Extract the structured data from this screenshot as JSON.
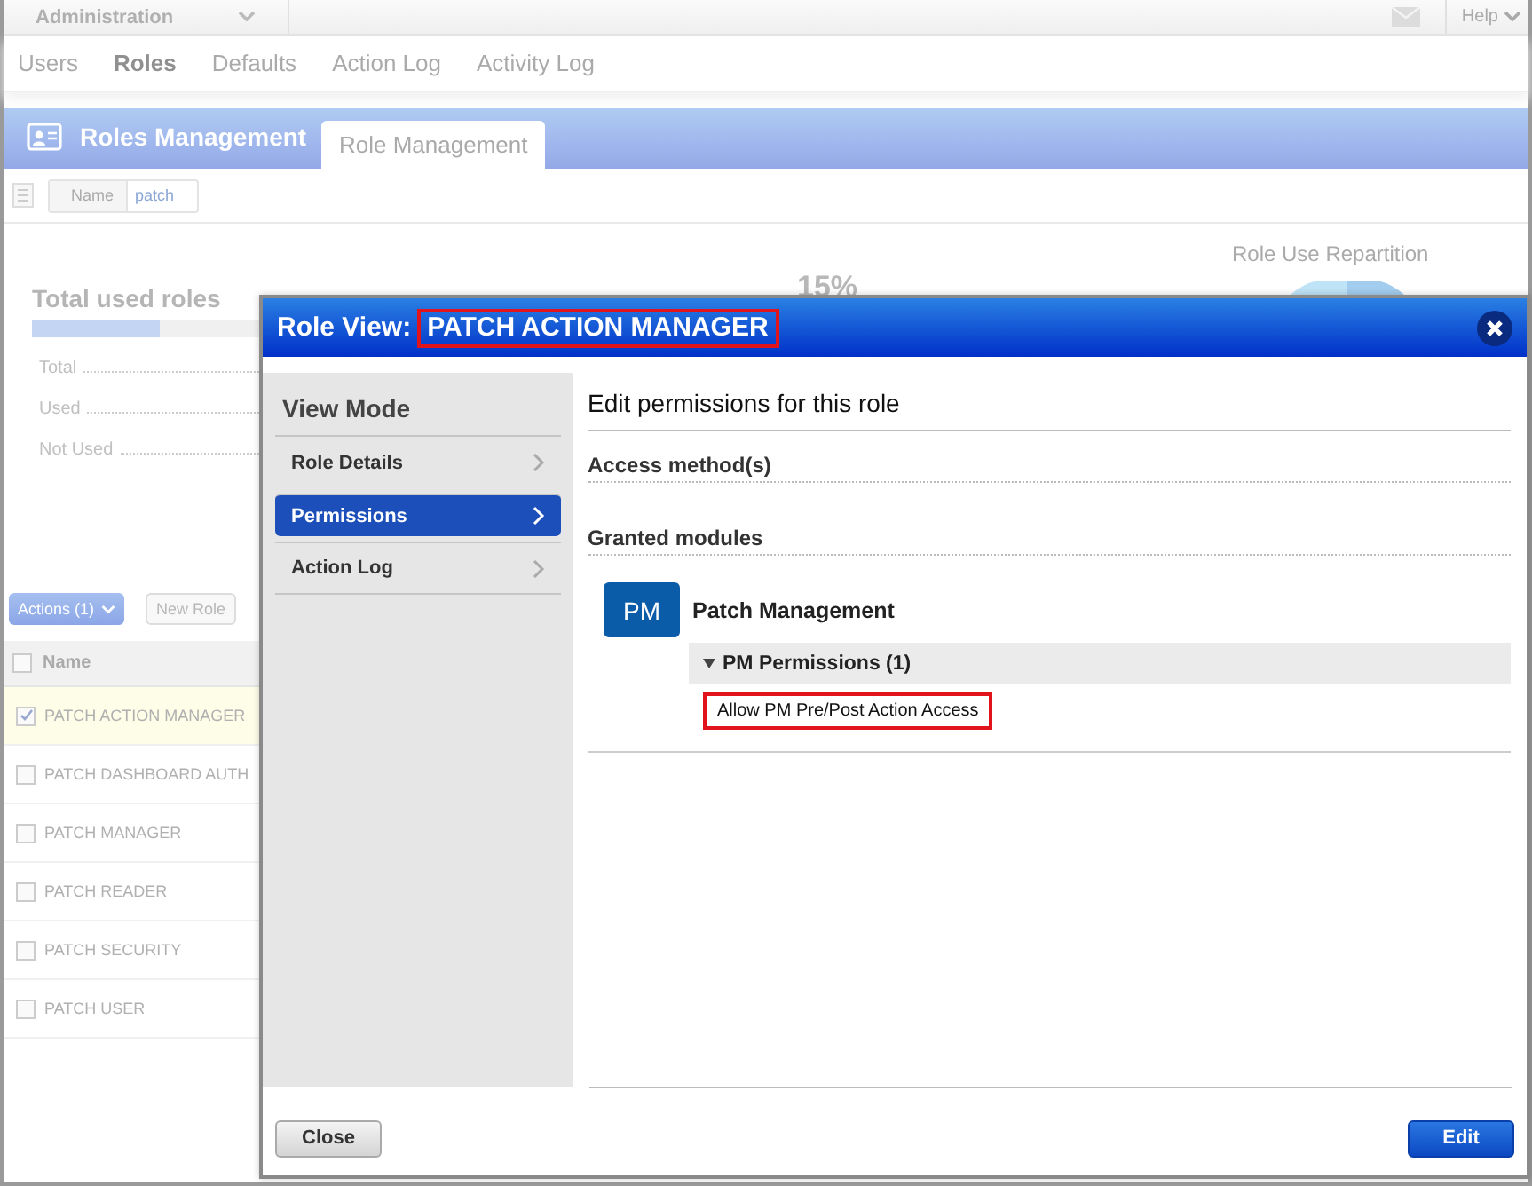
{
  "top_bar": {
    "app_menu": "Administration",
    "help": "Help"
  },
  "nav": [
    {
      "label": "Users",
      "selected": false
    },
    {
      "label": "Roles",
      "selected": true
    },
    {
      "label": "Defaults",
      "selected": false
    },
    {
      "label": "Action Log",
      "selected": false
    },
    {
      "label": "Activity Log",
      "selected": false
    }
  ],
  "header": {
    "title": "Roles Management",
    "tabs": [
      {
        "label": "Role Management",
        "selected": true
      }
    ]
  },
  "filter": {
    "label": "Name",
    "value": "patch"
  },
  "summary": {
    "title": "Total used roles",
    "level": 0.55,
    "rows": [
      "Total",
      "Used",
      "Not Used"
    ],
    "percent": "15%",
    "chart_title": "Role Use Repartition"
  },
  "toolbar": {
    "actions": "Actions (1)",
    "new_role": "New Role"
  },
  "table": {
    "column": "Name",
    "all_checked": false,
    "rows": [
      {
        "name": "PATCH ACTION MANAGER",
        "checked": true
      },
      {
        "name": "PATCH DASHBOARD AUTH",
        "checked": false
      },
      {
        "name": "PATCH MANAGER",
        "checked": false
      },
      {
        "name": "PATCH READER",
        "checked": false
      },
      {
        "name": "PATCH SECURITY",
        "checked": false
      },
      {
        "name": "PATCH USER",
        "checked": false
      }
    ]
  },
  "dialog": {
    "title_prefix": "Role View:",
    "role_name": "PATCH ACTION MANAGER",
    "sidebar": {
      "heading": "View Mode",
      "items": [
        {
          "label": "Role Details",
          "selected": false
        },
        {
          "label": "Permissions",
          "selected": true
        },
        {
          "label": "Action Log",
          "selected": false
        }
      ]
    },
    "content": {
      "heading": "Edit permissions for this role",
      "sections": [
        "Access method(s)",
        "Granted modules"
      ],
      "module": {
        "badge": "PM",
        "name": "Patch Management",
        "group": {
          "label": "PM Permissions (1)",
          "expanded": true,
          "permissions": [
            "Allow PM Pre/Post Action Access"
          ]
        }
      }
    },
    "buttons": [
      {
        "label": "Close",
        "kind": "secondary"
      },
      {
        "label": "Edit",
        "kind": "primary"
      }
    ]
  }
}
